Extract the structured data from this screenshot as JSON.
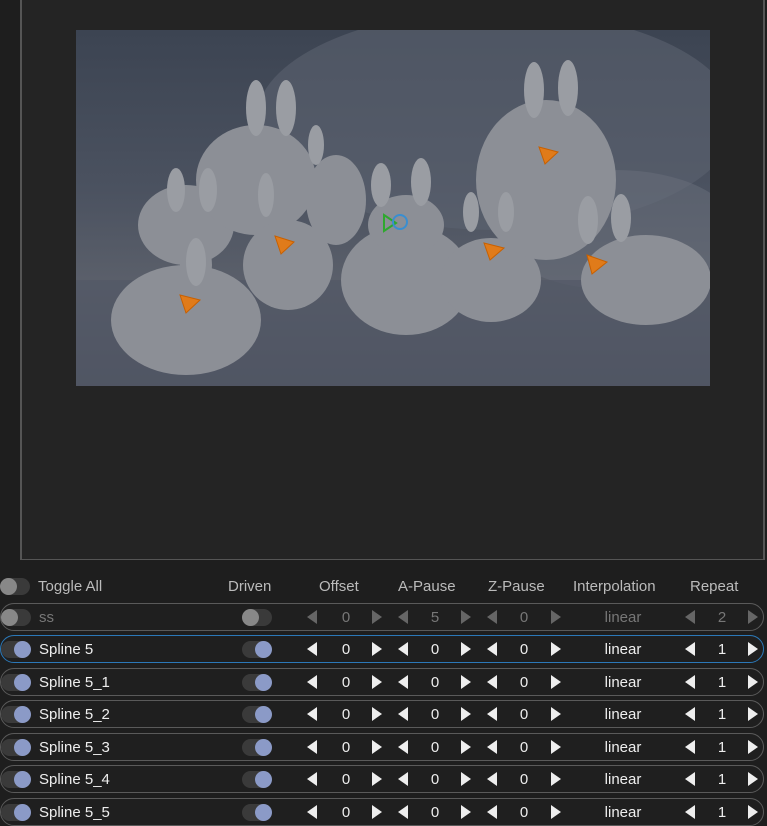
{
  "header": {
    "toggle_all": "Toggle All",
    "driven": "Driven",
    "offset": "Offset",
    "a_pause": "A-Pause",
    "z_pause": "Z-Pause",
    "interpolation": "Interpolation",
    "repeat": "Repeat"
  },
  "rows": [
    {
      "name": "ss",
      "enabled": false,
      "driven": false,
      "offset": "0",
      "a_pause": "5",
      "z_pause": "0",
      "interpolation": "linear",
      "repeat": "2"
    },
    {
      "name": "Spline 5",
      "enabled": true,
      "driven": true,
      "offset": "0",
      "a_pause": "0",
      "z_pause": "0",
      "interpolation": "linear",
      "repeat": "1"
    },
    {
      "name": "Spline 5_1",
      "enabled": true,
      "driven": true,
      "offset": "0",
      "a_pause": "0",
      "z_pause": "0",
      "interpolation": "linear",
      "repeat": "1"
    },
    {
      "name": "Spline 5_2",
      "enabled": true,
      "driven": true,
      "offset": "0",
      "a_pause": "0",
      "z_pause": "0",
      "interpolation": "linear",
      "repeat": "1"
    },
    {
      "name": "Spline 5_3",
      "enabled": true,
      "driven": true,
      "offset": "0",
      "a_pause": "0",
      "z_pause": "0",
      "interpolation": "linear",
      "repeat": "1"
    },
    {
      "name": "Spline 5_4",
      "enabled": true,
      "driven": true,
      "offset": "0",
      "a_pause": "0",
      "z_pause": "0",
      "interpolation": "linear",
      "repeat": "1"
    },
    {
      "name": "Spline 5_5",
      "enabled": true,
      "driven": true,
      "offset": "0",
      "a_pause": "0",
      "z_pause": "0",
      "interpolation": "linear",
      "repeat": "1"
    }
  ],
  "colors": {
    "marker_orange": "#e07b1a",
    "marker_green": "#2ea82e",
    "marker_blue": "#3a8ed0",
    "toggle_on": "#8b9ac7",
    "selected_border": "#2b78b8"
  }
}
